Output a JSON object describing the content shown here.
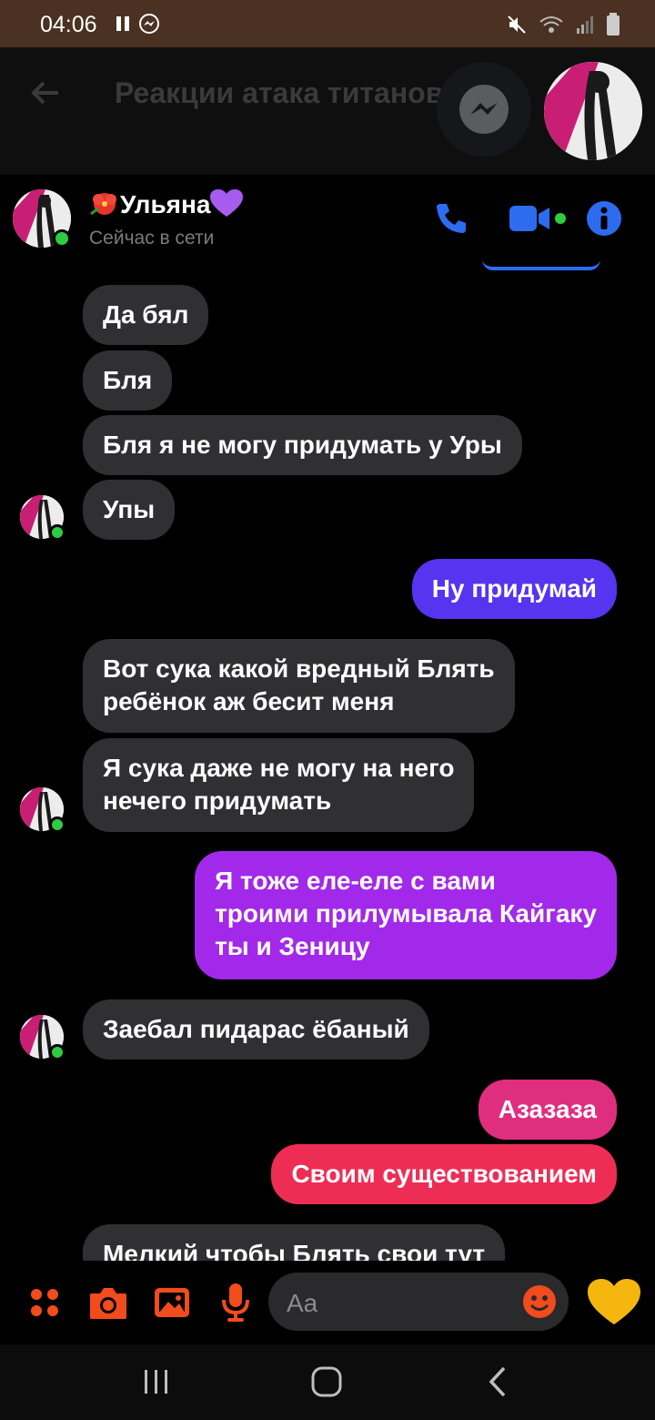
{
  "status_bar": {
    "time": "04:06"
  },
  "background_window": {
    "title": "Реакции атака титанов"
  },
  "chat": {
    "contact": {
      "name": "Ульяна",
      "status": "Сейчас в сети"
    },
    "messages": [
      {
        "text": "Да бял",
        "dir": "in"
      },
      {
        "text": "Бля",
        "dir": "in"
      },
      {
        "text": "Бля я не могу придумать у Уры",
        "dir": "in"
      },
      {
        "text": "Упы",
        "dir": "in"
      },
      {
        "text": "Ну придумай",
        "dir": "out"
      },
      {
        "text": "Вот сука какой вредный Блять\nребёнок аж бесит меня",
        "dir": "in"
      },
      {
        "text": "Я сука даже не могу на него\nнечего придумать",
        "dir": "in"
      },
      {
        "text": "Я тоже еле-еле с вами\nтроими прилумывала Кайгаку\nты и Зеницу",
        "dir": "out"
      },
      {
        "text": "Заебал пидарас ёбаный",
        "dir": "in"
      },
      {
        "text": "Азазаза",
        "dir": "out"
      },
      {
        "text": "Своим существованием",
        "dir": "out"
      },
      {
        "text": "Мелкий чтобы Блять свои тут",
        "dir": "in"
      }
    ]
  },
  "composer": {
    "placeholder": "Aa"
  },
  "icons": [
    "back-arrow-icon",
    "messenger-icon",
    "phone-icon",
    "video-icon",
    "info-icon",
    "menu-dots-icon",
    "camera-icon",
    "gallery-icon",
    "microphone-icon",
    "emoji-icon",
    "heart-icon",
    "recent-apps-icon",
    "home-icon",
    "back-icon"
  ],
  "colors": {
    "accent_blue": "#2d6cf0",
    "accent_orange": "#f24b1c",
    "online": "#2ecc40"
  }
}
